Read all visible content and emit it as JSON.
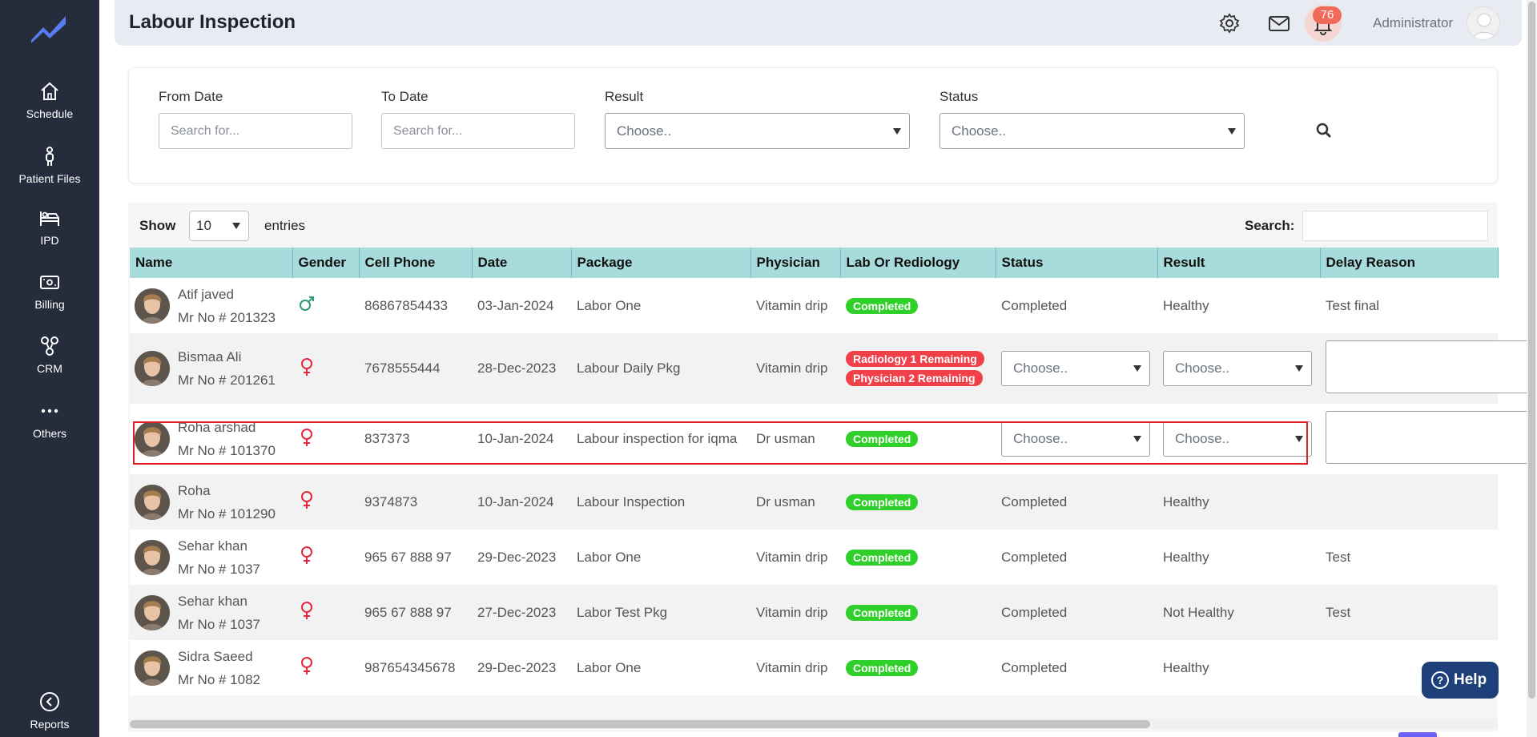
{
  "sidebar": {
    "items": [
      {
        "label": "Schedule",
        "icon": "home-icon"
      },
      {
        "label": "Patient Files",
        "icon": "person-icon"
      },
      {
        "label": "IPD",
        "icon": "bed-icon"
      },
      {
        "label": "Billing",
        "icon": "money-icon"
      },
      {
        "label": "CRM",
        "icon": "crm-icon"
      },
      {
        "label": "Others",
        "icon": "more-icon"
      }
    ],
    "reports_label": "Reports"
  },
  "header": {
    "title": "Labour Inspection",
    "notification_count": "76",
    "user_name": "Administrator"
  },
  "filters": {
    "from_date_label": "From Date",
    "from_date_placeholder": "Search for...",
    "to_date_label": "To Date",
    "to_date_placeholder": "Search for...",
    "result_label": "Result",
    "result_value": "Choose..",
    "status_label": "Status",
    "status_value": "Choose.."
  },
  "table_controls": {
    "show_label": "Show",
    "entries_value": "10",
    "entries_label": "entries",
    "search_label": "Search:"
  },
  "columns": [
    "Name",
    "Gender",
    "Cell Phone",
    "Date",
    "Package",
    "Physician",
    "Lab Or Rediology",
    "Status",
    "Result",
    "Delay Reason"
  ],
  "rows": [
    {
      "name": "Atif javed",
      "mr": "Mr No # 201323",
      "gender": "male",
      "phone": "86867854433",
      "date": "03-Jan-2024",
      "package": "Labor One",
      "physician": "Vitamin drip",
      "lab": [
        "Completed"
      ],
      "status": "Completed",
      "result": "Healthy",
      "delay": "Test final"
    },
    {
      "name": "Bismaa Ali",
      "mr": "Mr No # 201261",
      "gender": "female",
      "phone": "7678555444",
      "date": "28-Dec-2023",
      "package": "Labour Daily Pkg",
      "physician": "Vitamin drip",
      "lab": [
        "Radiology 1 Remaining",
        "Physician 2 Remaining"
      ],
      "status": "Choose..",
      "result": "Choose..",
      "delay": ""
    },
    {
      "name": "Roha arshad",
      "mr": "Mr No # 101370",
      "gender": "female",
      "phone": "837373",
      "date": "10-Jan-2024",
      "package": "Labour inspection for iqma",
      "physician": "Dr usman",
      "lab": [
        "Completed"
      ],
      "status": "Choose..",
      "result": "Choose..",
      "delay": ""
    },
    {
      "name": "Roha",
      "mr": "Mr No # 101290",
      "gender": "female",
      "phone": "9374873",
      "date": "10-Jan-2024",
      "package": "Labour Inspection",
      "physician": "Dr usman",
      "lab": [
        "Completed"
      ],
      "status": "Completed",
      "result": "Healthy",
      "delay": ""
    },
    {
      "name": "Sehar khan",
      "mr": "Mr No # 1037",
      "gender": "female",
      "phone": "965 67 888 97",
      "date": "29-Dec-2023",
      "package": "Labor One",
      "physician": "Vitamin drip",
      "lab": [
        "Completed"
      ],
      "status": "Completed",
      "result": "Healthy",
      "delay": "Test"
    },
    {
      "name": "Sehar khan",
      "mr": "Mr No # 1037",
      "gender": "female",
      "phone": "965 67 888 97",
      "date": "27-Dec-2023",
      "package": "Labor Test Pkg",
      "physician": "Vitamin drip",
      "lab": [
        "Completed"
      ],
      "status": "Completed",
      "result": "Not Healthy",
      "delay": "Test"
    },
    {
      "name": "Sidra Saeed",
      "mr": "Mr No # 1082",
      "gender": "female",
      "phone": "987654345678",
      "date": "29-Dec-2023",
      "package": "Labor One",
      "physician": "Vitamin drip",
      "lab": [
        "Completed"
      ],
      "status": "Completed",
      "result": "Healthy",
      "delay": ""
    }
  ],
  "help_label": "Help",
  "colors": {
    "sidebar": "#252d3d",
    "table_header": "#a8dcdc",
    "badge_green": "#2fd02a",
    "badge_red": "#f0404a",
    "male": "#2a9d6f",
    "female": "#e5263a",
    "help": "#1d3f7a"
  }
}
